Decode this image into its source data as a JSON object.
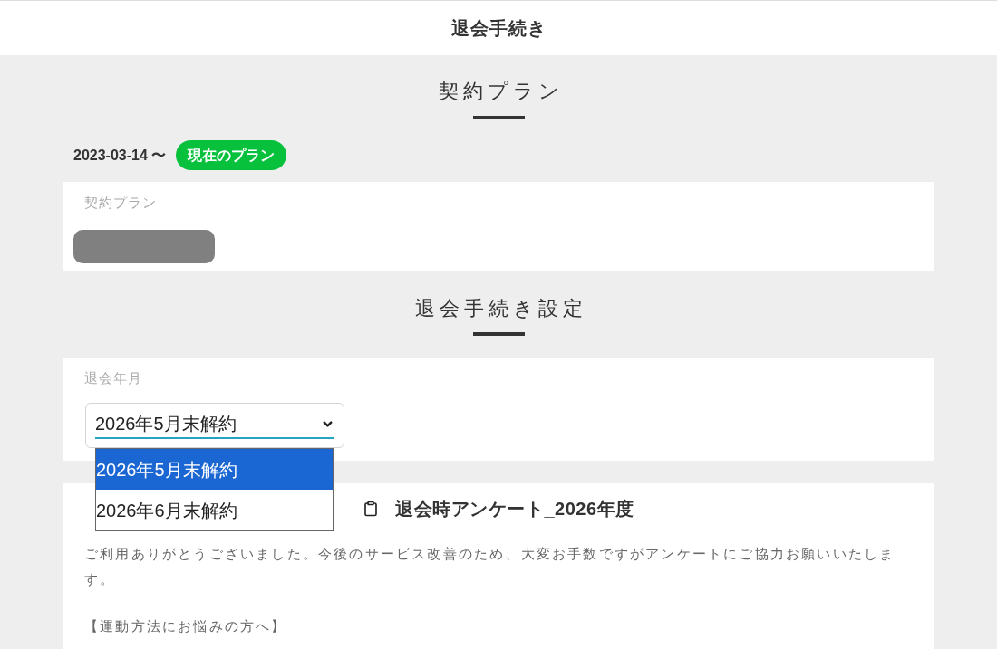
{
  "header": {
    "title": "退会手続き"
  },
  "plan_section": {
    "title": "契約プラン",
    "period": "2023-03-14 〜",
    "badge": "現在のプラン",
    "field_label": "契約プラン"
  },
  "withdrawal_section": {
    "title": "退会手続き設定",
    "field_label": "退会年月",
    "select": {
      "value": "2026年5月末解約",
      "expanded": true,
      "options": [
        {
          "label": "2026年5月末解約",
          "selected": true
        },
        {
          "label": "2026年6月末解約",
          "selected": false
        }
      ]
    }
  },
  "survey": {
    "title": "退会時アンケート_2026年度",
    "paragraphs": [
      "ご利用ありがとうございました。今後のサービス改善のため、大変お手数ですがアンケートにご協力お願いいたします。",
      "【運動方法にお悩みの方へ】"
    ]
  }
}
